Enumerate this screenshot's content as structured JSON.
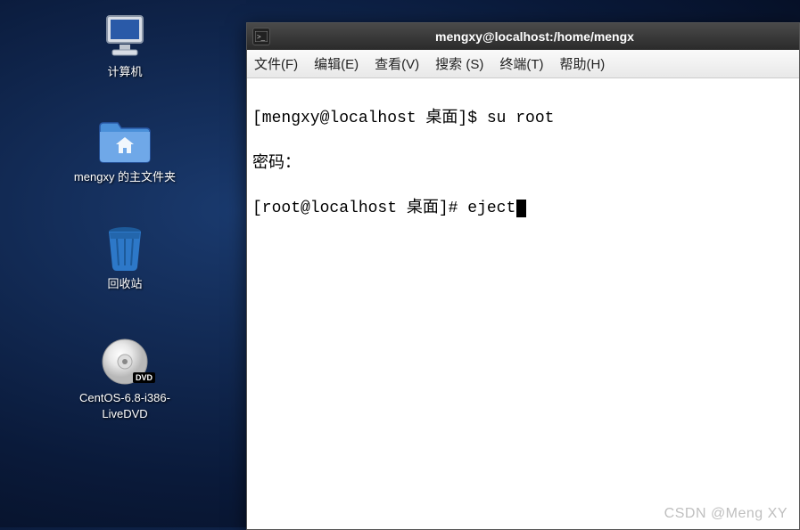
{
  "desktop": {
    "computer_label": "计算机",
    "folder_label": "mengxy 的主文件夹",
    "trash_label": "回收站",
    "dvd_label": "CentOS-6.8-i386-\nLiveDVD",
    "dvd_badge": "DVD"
  },
  "terminal": {
    "title": "mengxy@localhost:/home/mengx",
    "menu": {
      "file": "文件(F)",
      "edit": "编辑(E)",
      "view": "查看(V)",
      "search": "搜索 (S)",
      "terminal": "终端(T)",
      "help": "帮助(H)"
    },
    "lines": {
      "l1": "[mengxy@localhost 桌面]$ su root",
      "l2": "密码：",
      "l3": "[root@localhost 桌面]# eject"
    }
  },
  "watermark": "CSDN @Meng XY"
}
